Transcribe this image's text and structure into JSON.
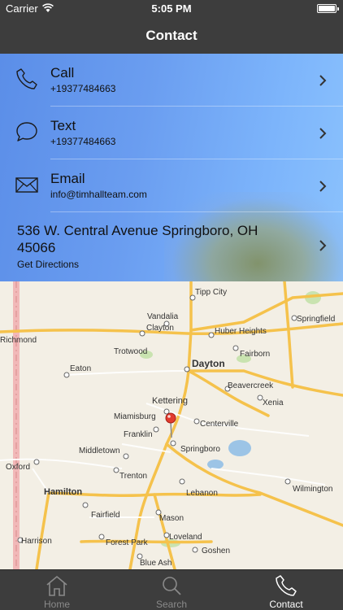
{
  "status_bar": {
    "carrier": "Carrier",
    "time": "5:05 PM"
  },
  "nav": {
    "title": "Contact"
  },
  "contact": {
    "call": {
      "label": "Call",
      "value": "+19377484663",
      "icon": "phone-icon"
    },
    "text": {
      "label": "Text",
      "value": "+19377484663",
      "icon": "speech-bubble-icon"
    },
    "email": {
      "label": "Email",
      "value": "info@timhallteam.com",
      "icon": "envelope-icon"
    },
    "address": {
      "label": "536 W. Central Avenue Springboro, OH 45066",
      "action": "Get Directions"
    }
  },
  "map": {
    "places": [
      "Tipp City",
      "Vandalia",
      "Clayton",
      "Huber Heights",
      "Springfield",
      "Richmond",
      "Trotwood",
      "Fairborn",
      "Eaton",
      "Dayton",
      "Beavercreek",
      "Kettering",
      "Xenia",
      "Miamisburg",
      "Centerville",
      "Franklin",
      "Springboro",
      "Middletown",
      "Oxford",
      "Trenton",
      "Hamilton",
      "Lebanon",
      "Wilmington",
      "Fairfield",
      "Mason",
      "Harrison",
      "Loveland",
      "Forest Park",
      "Goshen",
      "Blue Ash"
    ]
  },
  "tabs": [
    {
      "label": "Home",
      "icon": "home-icon",
      "active": false
    },
    {
      "label": "Search",
      "icon": "search-icon",
      "active": false
    },
    {
      "label": "Contact",
      "icon": "phone-icon",
      "active": true
    }
  ]
}
